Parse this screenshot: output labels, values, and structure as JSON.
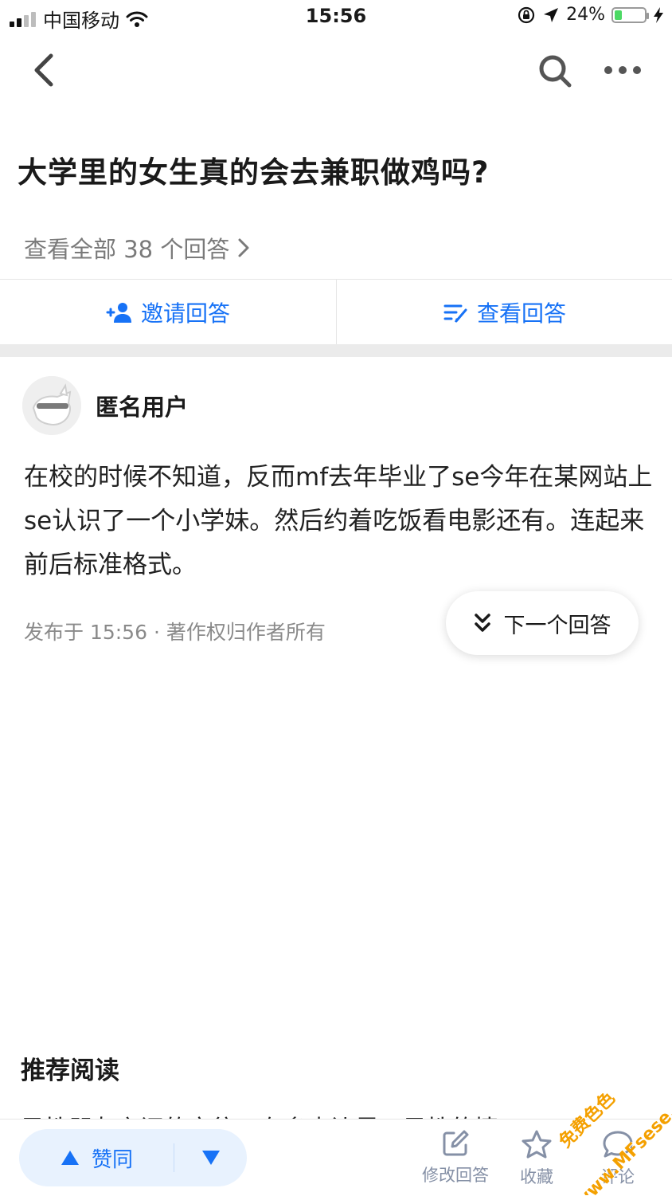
{
  "status_bar": {
    "carrier": "中国移动",
    "time": "15:56",
    "battery": "24%",
    "battery_level": 0.24
  },
  "nav": {
    "back_icon": "chevron-left-icon",
    "search_icon": "search-icon",
    "more_icon": "more-dots-icon"
  },
  "question": {
    "title": "大学里的女生真的会去兼职做鸡吗?",
    "view_all": "查看全部 38 个回答"
  },
  "actions": {
    "invite": "邀请回答",
    "view": "查看回答"
  },
  "answer": {
    "author": "匿名用户",
    "text": "在校的时候不知道，反而mf去年毕业了se今年在某网站上se认识了一个小学妹。然后约着吃饭看电影还有。连起来前后标准格式。",
    "meta": "发布于 15:56 · 著作权归作者所有"
  },
  "next_answer": "下一个回答",
  "recommend": {
    "title": "推荐阅读",
    "peek": "异性朋友之间的交往，有多少边界？异性的情"
  },
  "bottom_bar": {
    "upvote": "赞同",
    "edit": "修改回答",
    "collect": "收藏",
    "comment": "评论"
  },
  "watermark": {
    "line1": "免费色色",
    "line2": "www.MFsese.com"
  },
  "colors": {
    "accent": "#1772f6",
    "muted": "#8590a6",
    "watermark": "#f4a000"
  }
}
